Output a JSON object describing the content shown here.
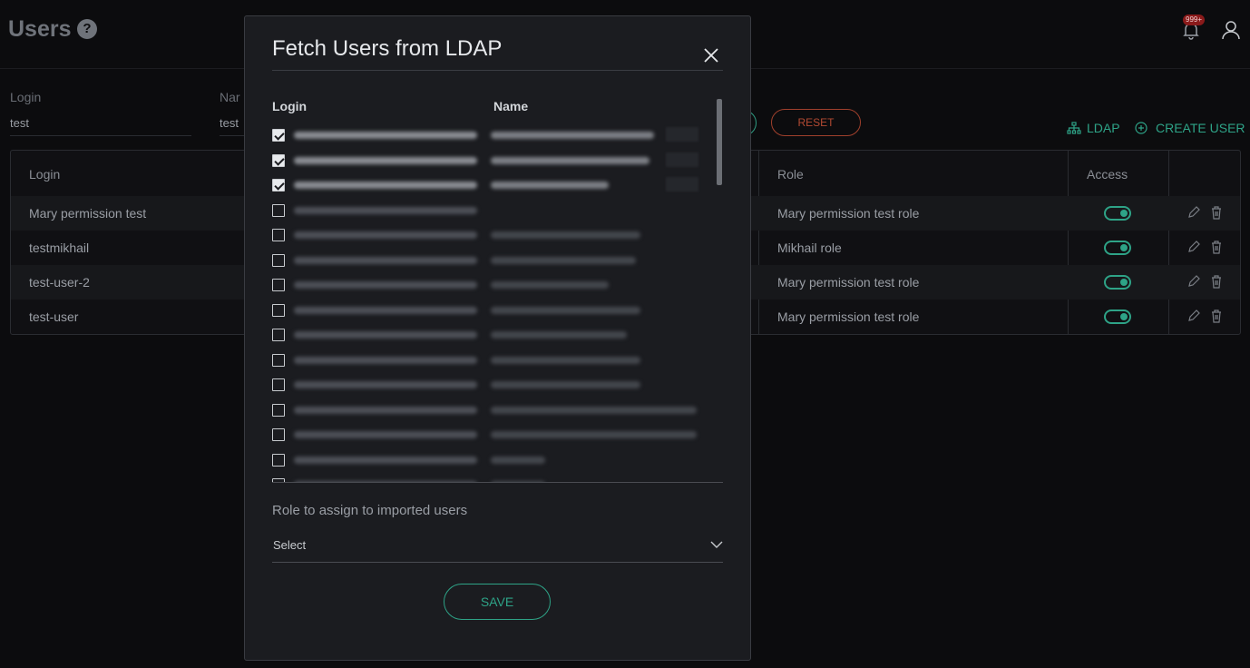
{
  "header": {
    "title": "Users",
    "help": "?",
    "notification_badge": "999+"
  },
  "filters": {
    "login_label": "Login",
    "login_value": "test",
    "name_label": "Nar",
    "name_value": "test",
    "reset_label": "RESET"
  },
  "actions": {
    "ldap_label": "LDAP",
    "create_user_label": "CREATE USER"
  },
  "table": {
    "columns": {
      "login": "Login",
      "role": "Role",
      "access": "Access"
    },
    "rows": [
      {
        "login": "Mary permission test",
        "role": "Mary permission test role",
        "access": true
      },
      {
        "login": "testmikhail",
        "role": "Mikhail role",
        "access": true
      },
      {
        "login": "test-user-2",
        "role": "Mary permission test role",
        "access": true
      },
      {
        "login": "test-user",
        "role": "Mary permission test role",
        "access": true
      }
    ]
  },
  "modal": {
    "title": "Fetch Users from LDAP",
    "col_login": "Login",
    "col_name": "Name",
    "rows": [
      {
        "checked": true
      },
      {
        "checked": true
      },
      {
        "checked": true
      },
      {
        "checked": false
      },
      {
        "checked": false
      },
      {
        "checked": false
      },
      {
        "checked": false
      },
      {
        "checked": false
      },
      {
        "checked": false
      },
      {
        "checked": false
      },
      {
        "checked": false
      },
      {
        "checked": false
      },
      {
        "checked": false
      },
      {
        "checked": false
      },
      {
        "checked": false
      }
    ],
    "role_label": "Role to assign to imported users",
    "role_select_value": "Select",
    "save_label": "SAVE"
  },
  "colors": {
    "accent": "#2ea387",
    "danger": "#b34a33",
    "background": "#0c0c0e",
    "modal_background": "#1b1c20"
  }
}
